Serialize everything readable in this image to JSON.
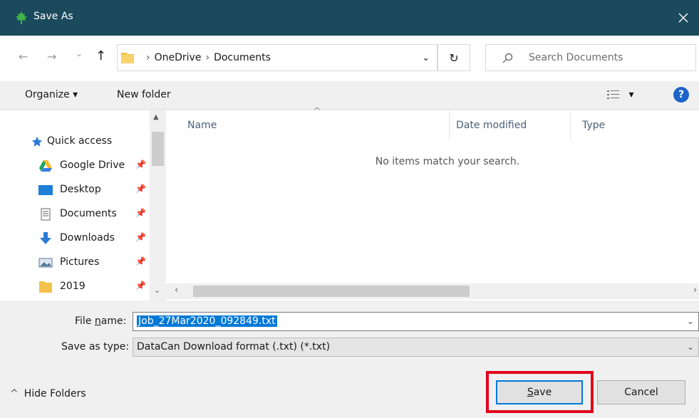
{
  "window": {
    "title": "Save As",
    "close_glyph": "✕",
    "app_icon": "maple-leaf-icon"
  },
  "navigation": {
    "back_glyph": "←",
    "forward_glyph": "→",
    "recent_glyph": "⌄",
    "up_glyph": "↑",
    "breadcrumb": [
      "OneDrive",
      "Documents"
    ],
    "breadcrumb_sep": "›",
    "dropdown_glyph": "⌄",
    "refresh_glyph": "↻",
    "search_placeholder": "Search Documents"
  },
  "toolbar": {
    "organize_label": "Organize ▾",
    "new_folder_label": "New folder",
    "view_glyph": "▾",
    "help_label": "?"
  },
  "sidebar": {
    "items": [
      {
        "label": "Quick access",
        "icon": "star-icon",
        "pin": ""
      },
      {
        "label": "Google Drive",
        "icon": "google-drive-icon",
        "pin": "📌"
      },
      {
        "label": "Desktop",
        "icon": "desktop-icon",
        "pin": "📌"
      },
      {
        "label": "Documents",
        "icon": "documents-icon",
        "pin": "📌"
      },
      {
        "label": "Downloads",
        "icon": "downloads-icon",
        "pin": "📌"
      },
      {
        "label": "Pictures",
        "icon": "pictures-icon",
        "pin": "📌"
      },
      {
        "label": "2019",
        "icon": "folder-icon",
        "pin": "📌"
      }
    ]
  },
  "file_list": {
    "columns": [
      "Name",
      "Date modified",
      "Type"
    ],
    "empty_message": "No items match your search.",
    "sort_glyph": "^"
  },
  "form": {
    "filename_label_pre": "File ",
    "filename_label_underline": "n",
    "filename_label_post": "ame:",
    "filename_value": "Job_27Mar2020_092849.txt",
    "type_label": "Save as type:",
    "type_value": "DataCan Download format (.txt) (*.txt)",
    "caret": "⌄"
  },
  "footer": {
    "hide_folders_label": "Hide Folders",
    "hide_glyph": "^",
    "save_label_underline": "S",
    "save_label_rest": "ave",
    "cancel_label": "Cancel",
    "grip": "⋰"
  },
  "colors": {
    "titlebar": "#1b4a5c",
    "accent": "#0078d7",
    "highlight": "#e0001b"
  }
}
